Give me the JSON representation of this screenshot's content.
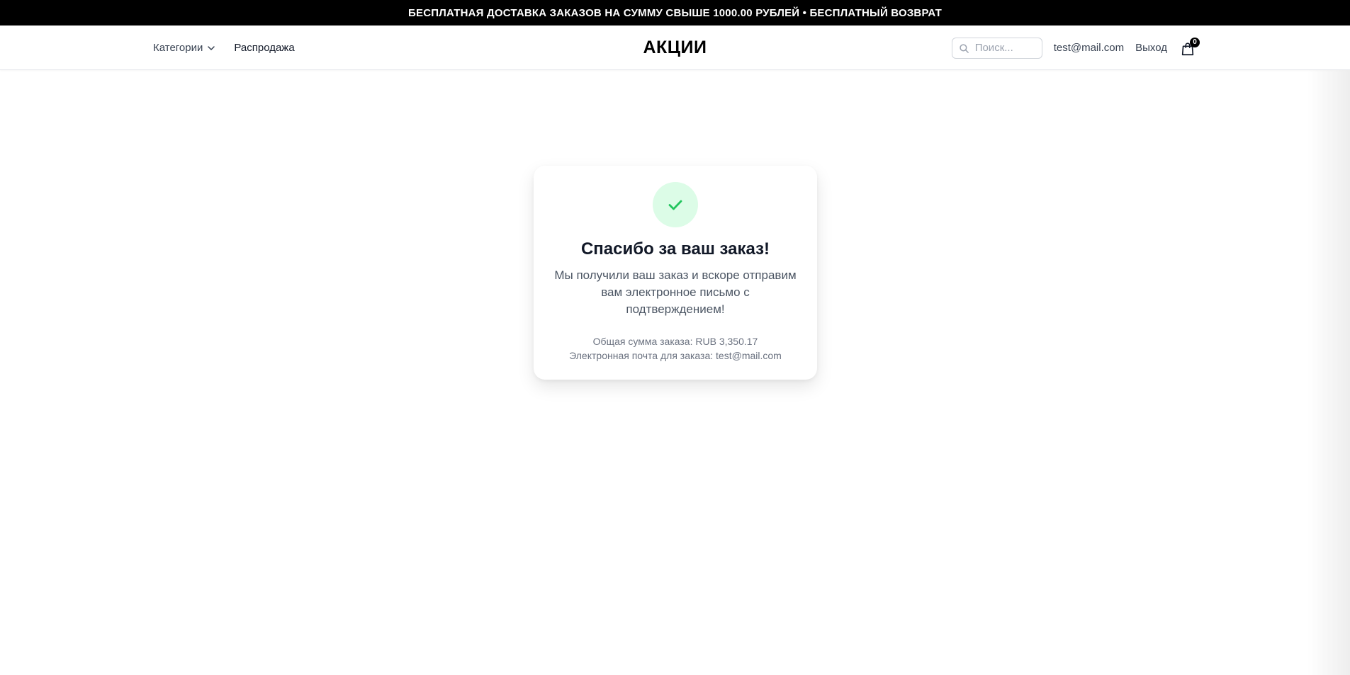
{
  "promo": {
    "text": "БЕСПЛАТНАЯ ДОСТАВКА ЗАКАЗОВ НА СУММУ СВЫШЕ 1000.00 РУБЛЕЙ • БЕСПЛАТНЫЙ ВОЗВРАТ"
  },
  "header": {
    "categories_label": "Категории",
    "sale_label": "Распродажа",
    "logo": "АКЦИИ",
    "search_placeholder": "Поиск...",
    "user_email": "test@mail.com",
    "logout_label": "Выход",
    "cart_count": "0"
  },
  "confirmation": {
    "title": "Спасибо за ваш заказ!",
    "message": "Мы получили ваш заказ и вскоре отправим вам электронное письмо с подтверждением!",
    "total_line": "Общая сумма заказа: RUB 3,350.17",
    "email_line": "Электронная почта для заказа: test@mail.com"
  },
  "icons": {
    "search": "search-icon",
    "chevron": "chevron-down-icon",
    "cart": "shopping-bag-icon",
    "check": "check-icon"
  },
  "colors": {
    "promo_bg": "#000000",
    "success_circle": "#dcfce7",
    "success_check": "#22c55e"
  }
}
